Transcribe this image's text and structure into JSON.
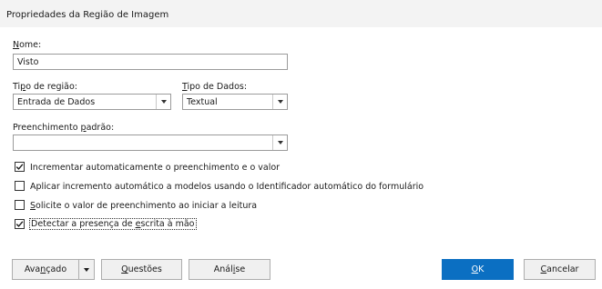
{
  "window": {
    "title": "Propriedades da Região de Imagem"
  },
  "name_field": {
    "label_pre": "",
    "label_u": "N",
    "label_post": "ome:",
    "value": "Visto"
  },
  "region_type": {
    "label_pre": "Ti",
    "label_u": "p",
    "label_post": "o de região:",
    "selected": "Entrada de Dados"
  },
  "data_type": {
    "label_pre": "",
    "label_u": "T",
    "label_post": "ipo de Dados:",
    "selected": "Textual"
  },
  "default_fill": {
    "label_pre": "Preenchimento ",
    "label_u": "p",
    "label_post": "adrão:",
    "selected": ""
  },
  "checkboxes": [
    {
      "pre": "",
      "u": "",
      "post": "Incrementar automaticamente o preenchimento e o valor",
      "checked": true
    },
    {
      "pre": "",
      "u": "",
      "post": "Aplicar incremento automático a modelos usando o Identificador automático do formulário",
      "checked": false
    },
    {
      "pre": "",
      "u": "S",
      "post": "olicite o valor de preenchimento ao iniciar a leitura",
      "checked": false
    },
    {
      "pre": "Detectar a presença de ",
      "u": "e",
      "post": "scrita à mão",
      "checked": true
    }
  ],
  "buttons": {
    "advanced": {
      "pre": "Ava",
      "u": "n",
      "post": "çado"
    },
    "questions": {
      "pre": "",
      "u": "Q",
      "post": "uestões"
    },
    "analysis": {
      "pre": "Anál",
      "u": "i",
      "post": "se"
    },
    "ok": {
      "pre": "",
      "u": "O",
      "post": "K"
    },
    "cancel": {
      "pre": "",
      "u": "C",
      "post": "ancelar"
    }
  },
  "colors": {
    "primary": "#0b6fc2",
    "titlebar": "#f3f3f3"
  },
  "icons": {
    "dropdown": "chevron-down-icon",
    "split": "caret-down-icon",
    "check": "checkmark-icon"
  }
}
